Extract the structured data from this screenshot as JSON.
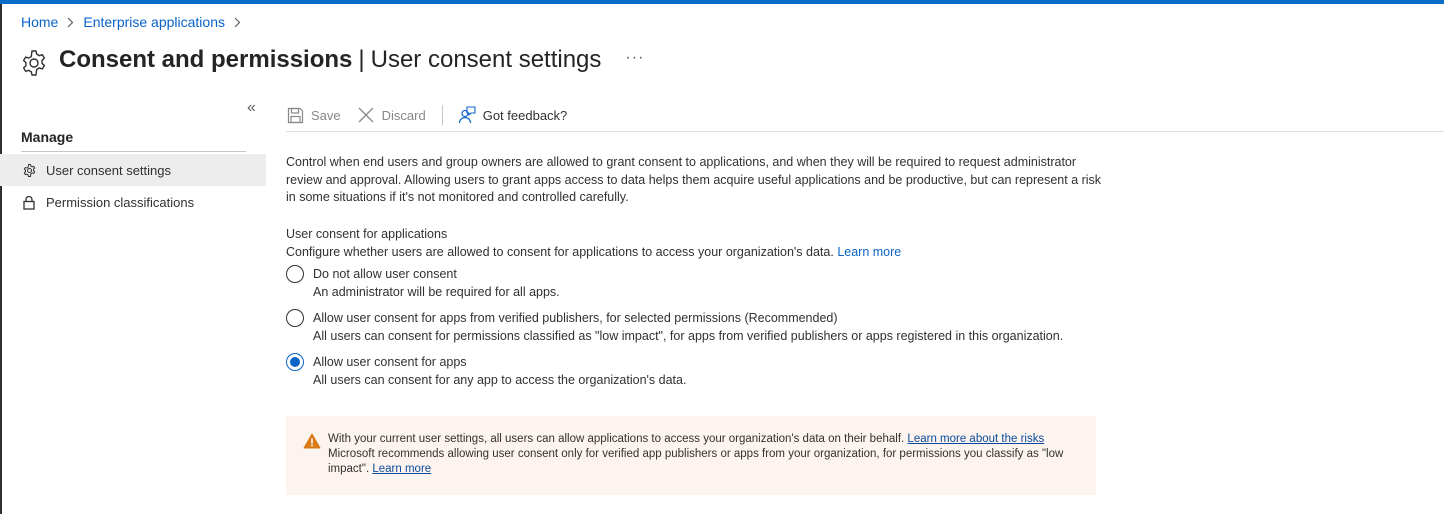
{
  "breadcrumb": {
    "home": "Home",
    "enterprise_apps": "Enterprise applications"
  },
  "header": {
    "title_main": "Consent and permissions",
    "separator": "|",
    "title_sub": "User consent settings",
    "more": "···"
  },
  "sidebar": {
    "collapse": "«",
    "heading": "Manage",
    "items": [
      {
        "label": "User consent settings",
        "icon": "gear-icon",
        "active": true
      },
      {
        "label": "Permission classifications",
        "icon": "lock-icon",
        "active": false
      }
    ]
  },
  "toolbar": {
    "save_label": "Save",
    "discard_label": "Discard",
    "feedback_label": "Got feedback?"
  },
  "intro": {
    "text": "Control when end users and group owners are allowed to grant consent to applications, and when they will be required to request administrator review and approval. Allowing users to grant apps access to data helps them acquire useful applications and be productive, but can represent a risk in some situations if it's not monitored and controlled carefully."
  },
  "consent": {
    "title": "User consent for applications",
    "description": "Configure whether users are allowed to consent for applications to access your organization's data.",
    "learn_more": "Learn more",
    "options": [
      {
        "label": "Do not allow user consent",
        "hint": "An administrator will be required for all apps.",
        "selected": false
      },
      {
        "label": "Allow user consent for apps from verified publishers, for selected permissions (Recommended)",
        "hint": "All users can consent for permissions classified as \"low impact\", for apps from verified publishers or apps registered in this organization.",
        "selected": false
      },
      {
        "label": "Allow user consent for apps",
        "hint": "All users can consent for any app to access the organization's data.",
        "selected": true
      }
    ]
  },
  "warning": {
    "line1": "With your current user settings, all users can allow applications to access your organization's data on their behalf.",
    "link1": "Learn more about the risks",
    "line2": "Microsoft recommends allowing user consent only for verified app publishers or apps from your organization, for permissions you classify as \"low impact\".",
    "link2": "Learn more"
  },
  "colors": {
    "accent": "#0a64c8",
    "warning_bg": "#fdf4ef",
    "warning_icon": "#d97a14"
  }
}
